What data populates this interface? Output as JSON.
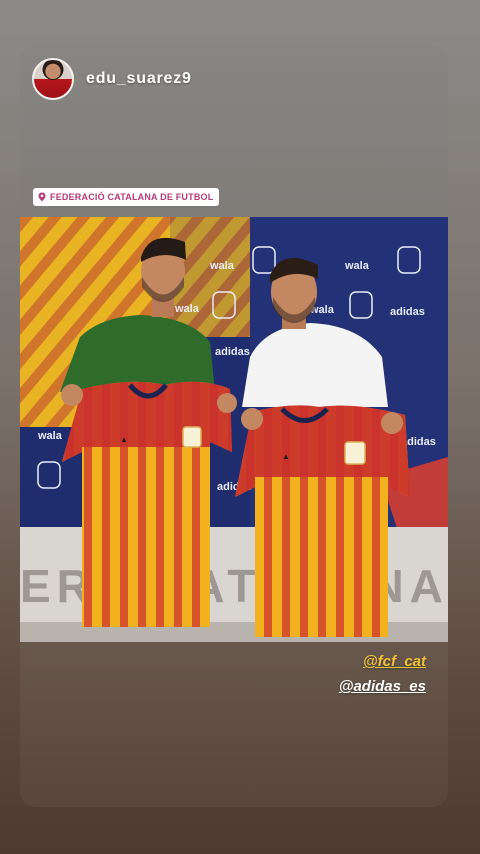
{
  "story": {
    "username": "edu_suarez9",
    "location_sticker": "FEDERACIÓ CATALANA DE FUTBOL",
    "mentions": [
      "@fcf_cat",
      "@adidas_es"
    ]
  },
  "photo": {
    "backdrop_brands": [
      "wala",
      "adidas"
    ],
    "wall_text": "ERA CATALANA D"
  },
  "colors": {
    "mention_primary": "#f2c23a",
    "mention_secondary": "#ffffff",
    "location_text": "#b73a7a",
    "jersey_yellow": "#f2b11e",
    "jersey_red": "#d2442d",
    "backdrop_blue": "#1f2c6e"
  },
  "icons": {
    "avatar": "profile-avatar",
    "location": "location-pin-icon"
  }
}
